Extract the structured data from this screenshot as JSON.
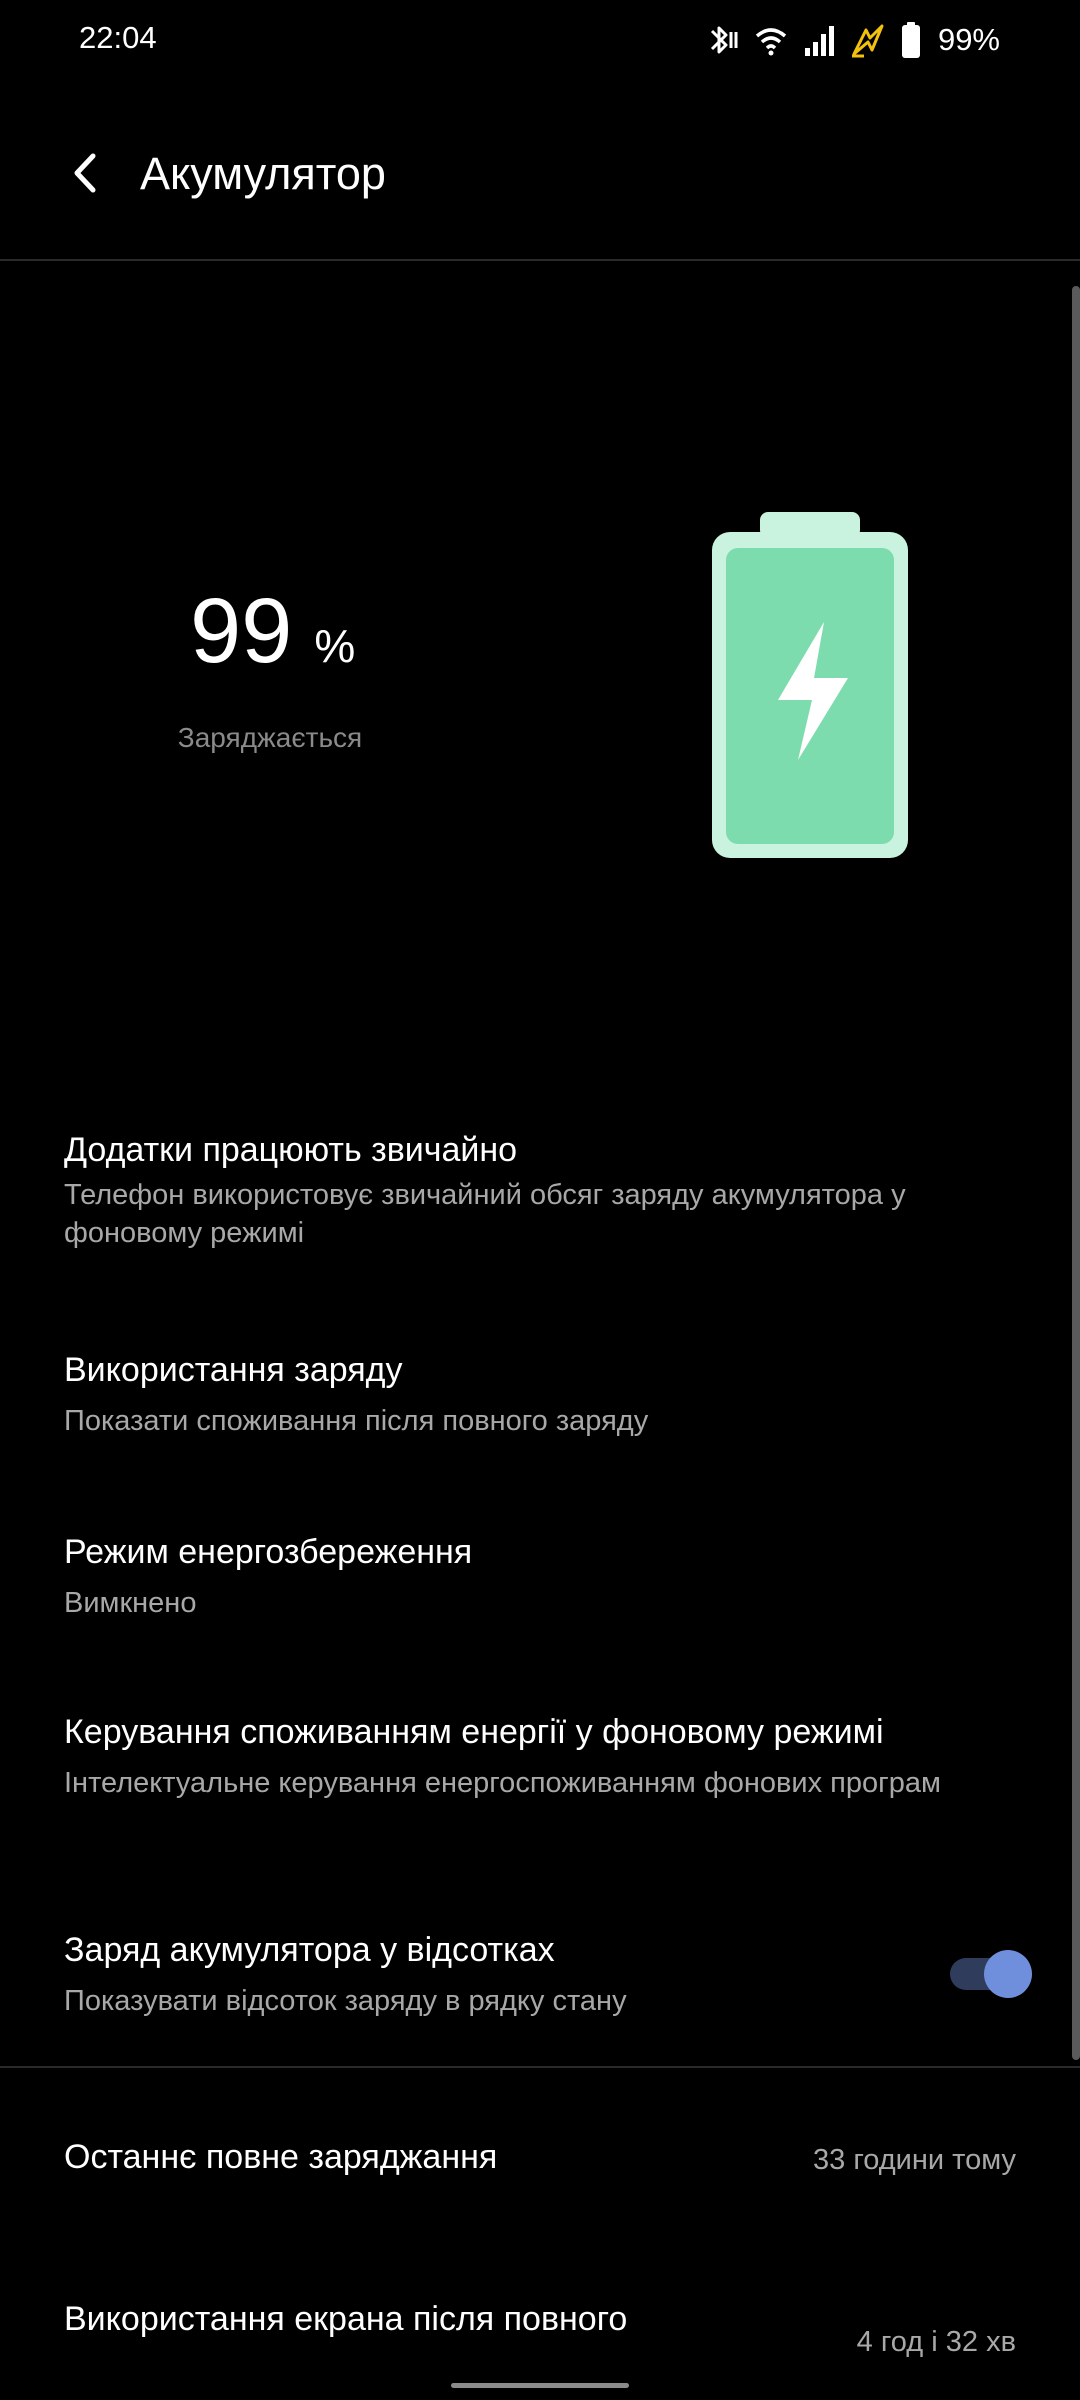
{
  "status_bar": {
    "time": "22:04",
    "battery_percent": "99%",
    "icons": [
      "bluetooth-icon",
      "wifi-icon",
      "signal-icon",
      "charging-icon",
      "battery-icon"
    ],
    "charging_color": "#f4c20d"
  },
  "header": {
    "title": "Акумулятор",
    "back_icon": "back-arrow-icon"
  },
  "battery": {
    "level": "99",
    "unit": "%",
    "status": "Заряджається",
    "icon": "battery-charging-icon",
    "fill_color": "#7ddcae",
    "outline_color": "#c9f3df"
  },
  "settings": [
    {
      "title": "Додатки працюють звичайно",
      "subtitle": "Телефон використовує звичайний обсяг заряду акумулятора у фоновому режимі"
    },
    {
      "title": "Використання заряду",
      "subtitle": "Показати споживання після повного заряду"
    },
    {
      "title": "Режим енергозбереження",
      "subtitle": "Вимкнено"
    },
    {
      "title": "Керування споживанням енергії у фоновому режимі",
      "subtitle": "Інтелектуальне керування енергоспоживанням фонових програм"
    },
    {
      "title": "Заряд акумулятора у відсотках",
      "subtitle": "Показувати відсоток заряду в рядку стану",
      "toggle_on": true
    }
  ],
  "info": [
    {
      "label": "Останнє повне заряджання",
      "value": "33 години тому"
    },
    {
      "label": "Використання екрана після повного",
      "value": "4 год і 32 хв"
    }
  ],
  "colors": {
    "background": "#000000",
    "accent": "#6f8fdc"
  }
}
